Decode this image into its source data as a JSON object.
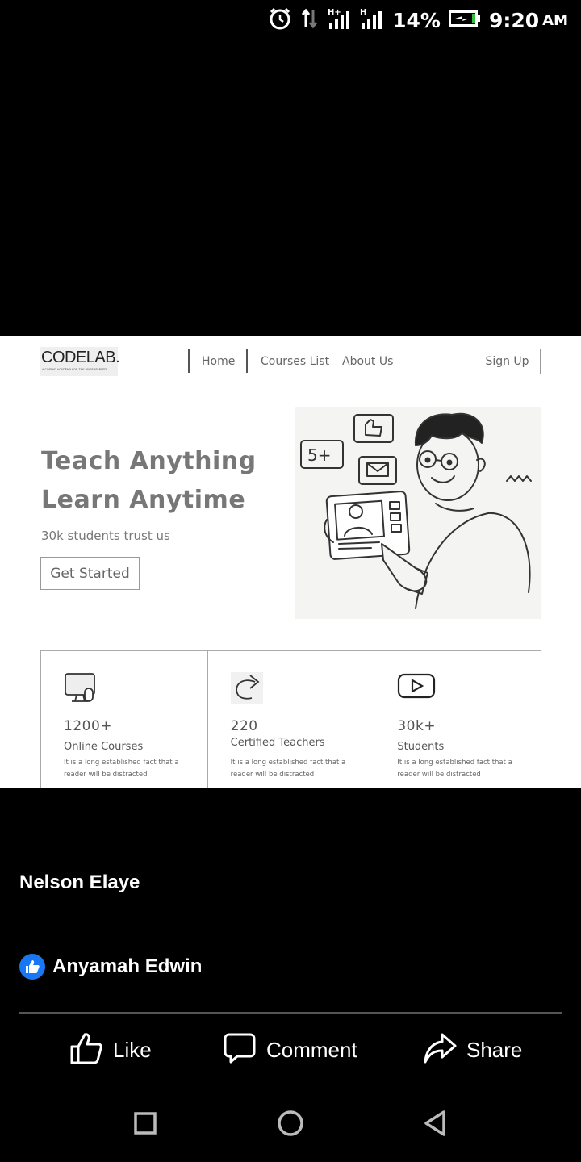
{
  "status_bar": {
    "icons": [
      "alarm-icon",
      "data-transfer-icon",
      "signal-h-plus-icon",
      "signal-h-icon",
      "battery-charging-icon"
    ],
    "battery": "14%",
    "time": "9:20",
    "ampm": "AM"
  },
  "post_image": {
    "logo": {
      "name": "CODELAB.",
      "tagline": "A CODING ACADEMY FOR THE UNDERSERVED"
    },
    "nav": {
      "links": [
        "Home",
        "Courses List",
        "About Us"
      ],
      "signup": "Sign Up"
    },
    "hero": {
      "title_line1": "Teach Anything",
      "title_line2": "Learn Anytime",
      "subtitle": "30k students trust us",
      "cta": "Get Started",
      "bubble_text": "5+"
    },
    "stats": [
      {
        "icon": "monitor-icon",
        "number": "1200+",
        "label": "Online Courses",
        "desc": "It is a long established fact that a reader will be distracted"
      },
      {
        "icon": "redo-arrow-icon",
        "number": "220",
        "label": "Certified Teachers",
        "desc": "It is a long established fact that a reader will be distracted"
      },
      {
        "icon": "play-icon",
        "number": "30k+",
        "label": "Students",
        "desc": "It is a long established fact that a reader will be distracted"
      }
    ]
  },
  "post": {
    "author": "Nelson Elaye",
    "reaction_by": "Anyamah Edwin",
    "actions": {
      "like": "Like",
      "comment": "Comment",
      "share": "Share"
    }
  },
  "system_nav": {
    "icons": [
      "recents-square-icon",
      "home-circle-icon",
      "back-triangle-icon"
    ]
  },
  "colors": {
    "background": "#000000",
    "text": "#ffffff",
    "like_blue": "#1877f2",
    "post_image_bg": "#ffffff"
  }
}
